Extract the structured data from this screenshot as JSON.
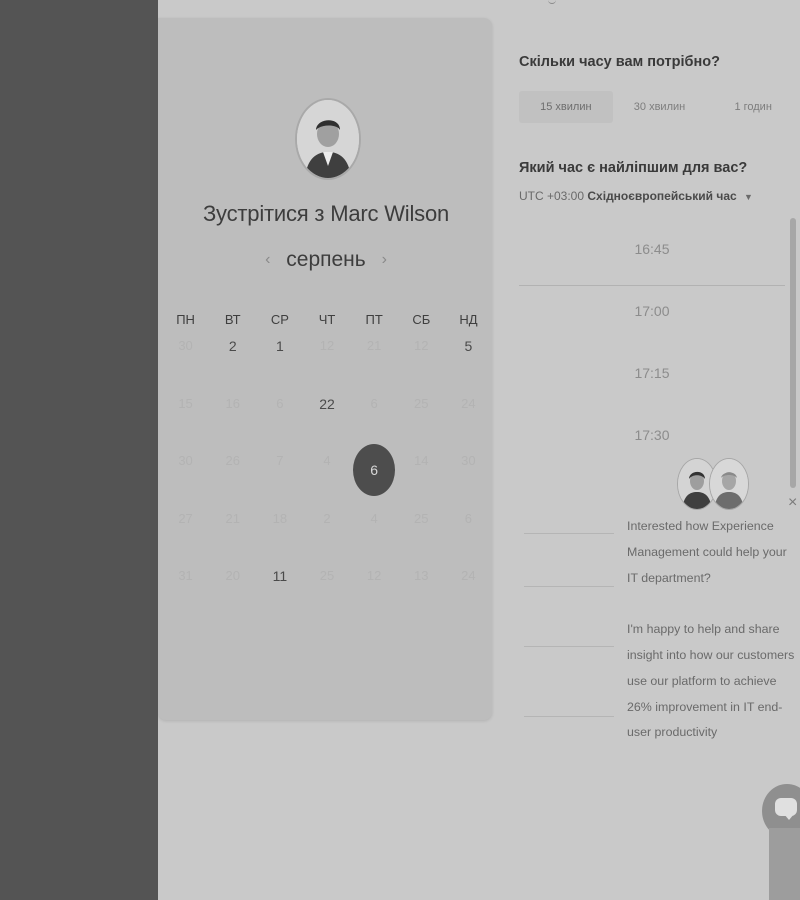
{
  "booking": {
    "title": "Зустрітися з Marc Wilson",
    "month": "серпень",
    "weekdays": [
      "ПН",
      "ВТ",
      "СР",
      "ЧТ",
      "ПТ",
      "СБ",
      "НД"
    ],
    "days": [
      [
        "30",
        "2",
        "1",
        "12",
        "21",
        "12",
        "5"
      ],
      [
        "15",
        "16",
        "6",
        "22",
        "6",
        "25",
        "24"
      ],
      [
        "30",
        "26",
        "7",
        "4",
        "6",
        "14",
        "30"
      ],
      [
        "27",
        "21",
        "18",
        "2",
        "4",
        "25",
        "6"
      ],
      [
        "31",
        "20",
        "11",
        "25",
        "12",
        "13",
        "24"
      ]
    ],
    "available_days": [
      "2",
      "1",
      "5",
      "22",
      "11"
    ],
    "selected_day": "6"
  },
  "duration": {
    "question": "Скільки часу вам потрібно?",
    "options": [
      "15 хвилин",
      "30 хвилин",
      "1 годин"
    ],
    "selected": "15 хвилин"
  },
  "time": {
    "question": "Який час є найліпшим для вас?",
    "tz_offset": "UTC +03:00",
    "tz_name": "Східноєвропейський час",
    "slots": [
      "16:45",
      "17:00",
      "17:15",
      "17:30"
    ]
  },
  "chat": {
    "message_1": "Interested how Experience Management could help your IT department?",
    "message_2": "I'm happy to help and share insight into how our customers use our platform to achieve 26% improvement in IT end-user productivity"
  }
}
